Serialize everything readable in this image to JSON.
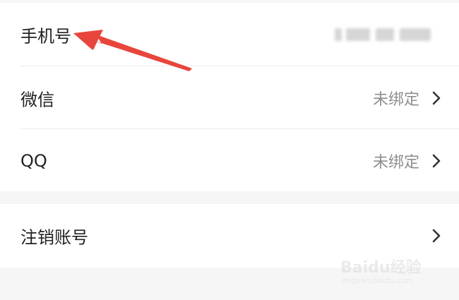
{
  "rows": [
    {
      "label": "手机号",
      "value": "",
      "has_chevron": false,
      "value_masked": true
    },
    {
      "label": "微信",
      "value": "未绑定",
      "has_chevron": true
    },
    {
      "label": "QQ",
      "value": "未绑定",
      "has_chevron": true
    }
  ],
  "cancel_row": {
    "label": "注销账号",
    "has_chevron": true
  },
  "icons": {
    "chevron": "chevron-right-icon",
    "annotation": "red-arrow-icon"
  },
  "colors": {
    "label": "#222222",
    "value": "#8e8e8e",
    "background": "#f6f6f6",
    "card": "#ffffff",
    "annotation": "#e8453c"
  },
  "watermark": {
    "main": "Baidu经验",
    "sub": "jingyan.baidu.com"
  }
}
